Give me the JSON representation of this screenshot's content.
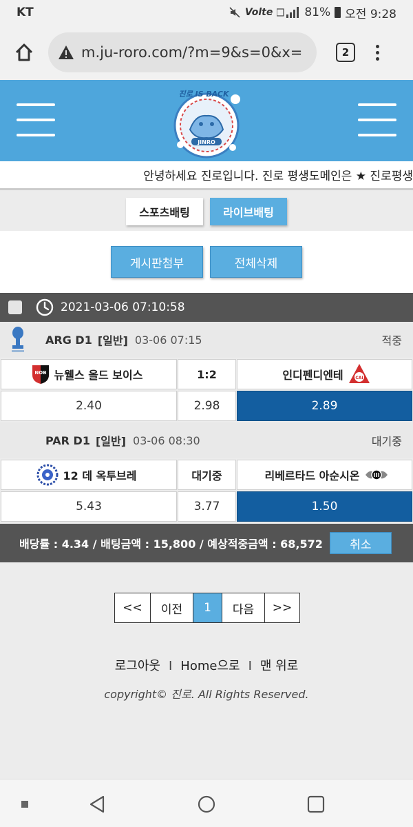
{
  "status_bar": {
    "carrier": "KT",
    "network": "Volte",
    "battery": "81%",
    "time": "오전 9:28"
  },
  "browser": {
    "url": "m.ju-roro.com/?m=9&s=0&x=",
    "tab_count": "2"
  },
  "header": {
    "logo_text": "JINRO",
    "logo_tagline": "진로 IS BACK"
  },
  "notice": "안녕하세요 진로입니다. 진로 평생도메인은 ★ 진로평생",
  "bet_tabs": [
    {
      "label": "스포츠배팅"
    },
    {
      "label": "라이브배팅"
    }
  ],
  "actions": {
    "attach_label": "게시판첨부",
    "delete_all_label": "전체삭제"
  },
  "datetime": "2021-03-06 07:10:58",
  "matches": [
    {
      "league": "ARG D1",
      "kind": "[일반]",
      "time": "03-06 07:15",
      "status": "적중",
      "home": "뉴웰스 올드 보이스",
      "center": "1:2",
      "away": "인디펜디엔테",
      "odds": [
        "2.40",
        "2.98",
        "2.89"
      ],
      "selected": 2,
      "home_badge": "NOB",
      "away_badge": "CAI"
    },
    {
      "league": "PAR D1",
      "kind": "[일반]",
      "time": "03-06 08:30",
      "status": "대기중",
      "home": "12 데 옥투브레",
      "center": "대기중",
      "away": "리베르타드 아순시온",
      "odds": [
        "5.43",
        "3.77",
        "1.50"
      ],
      "selected": 2
    }
  ],
  "summary": {
    "text": "배당률 : 4.34 / 배팅금액 : 15,800 / 예상적중금액 : 68,572",
    "cancel_label": "취소"
  },
  "pagination": {
    "first": "<<",
    "prev": "이전",
    "current": "1",
    "next": "다음",
    "last": ">>"
  },
  "footer": {
    "logout": "로그아웃",
    "home": "Home으로",
    "top": "맨 위로",
    "separator": "I",
    "copyright": "copyright© 진로. All Rights Reserved."
  },
  "colors": {
    "header_blue": "#4ea6dc",
    "button_blue": "#5aaee0",
    "selected_odd": "#135ea0",
    "dark_bar": "#545454"
  }
}
